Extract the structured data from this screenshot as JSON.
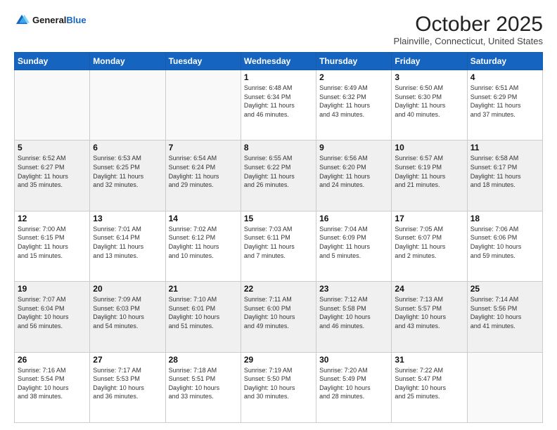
{
  "header": {
    "logo_general": "General",
    "logo_blue": "Blue",
    "month": "October 2025",
    "location": "Plainville, Connecticut, United States"
  },
  "weekdays": [
    "Sunday",
    "Monday",
    "Tuesday",
    "Wednesday",
    "Thursday",
    "Friday",
    "Saturday"
  ],
  "weeks": [
    [
      {
        "day": "",
        "info": ""
      },
      {
        "day": "",
        "info": ""
      },
      {
        "day": "",
        "info": ""
      },
      {
        "day": "1",
        "info": "Sunrise: 6:48 AM\nSunset: 6:34 PM\nDaylight: 11 hours\nand 46 minutes."
      },
      {
        "day": "2",
        "info": "Sunrise: 6:49 AM\nSunset: 6:32 PM\nDaylight: 11 hours\nand 43 minutes."
      },
      {
        "day": "3",
        "info": "Sunrise: 6:50 AM\nSunset: 6:30 PM\nDaylight: 11 hours\nand 40 minutes."
      },
      {
        "day": "4",
        "info": "Sunrise: 6:51 AM\nSunset: 6:29 PM\nDaylight: 11 hours\nand 37 minutes."
      }
    ],
    [
      {
        "day": "5",
        "info": "Sunrise: 6:52 AM\nSunset: 6:27 PM\nDaylight: 11 hours\nand 35 minutes."
      },
      {
        "day": "6",
        "info": "Sunrise: 6:53 AM\nSunset: 6:25 PM\nDaylight: 11 hours\nand 32 minutes."
      },
      {
        "day": "7",
        "info": "Sunrise: 6:54 AM\nSunset: 6:24 PM\nDaylight: 11 hours\nand 29 minutes."
      },
      {
        "day": "8",
        "info": "Sunrise: 6:55 AM\nSunset: 6:22 PM\nDaylight: 11 hours\nand 26 minutes."
      },
      {
        "day": "9",
        "info": "Sunrise: 6:56 AM\nSunset: 6:20 PM\nDaylight: 11 hours\nand 24 minutes."
      },
      {
        "day": "10",
        "info": "Sunrise: 6:57 AM\nSunset: 6:19 PM\nDaylight: 11 hours\nand 21 minutes."
      },
      {
        "day": "11",
        "info": "Sunrise: 6:58 AM\nSunset: 6:17 PM\nDaylight: 11 hours\nand 18 minutes."
      }
    ],
    [
      {
        "day": "12",
        "info": "Sunrise: 7:00 AM\nSunset: 6:15 PM\nDaylight: 11 hours\nand 15 minutes."
      },
      {
        "day": "13",
        "info": "Sunrise: 7:01 AM\nSunset: 6:14 PM\nDaylight: 11 hours\nand 13 minutes."
      },
      {
        "day": "14",
        "info": "Sunrise: 7:02 AM\nSunset: 6:12 PM\nDaylight: 11 hours\nand 10 minutes."
      },
      {
        "day": "15",
        "info": "Sunrise: 7:03 AM\nSunset: 6:11 PM\nDaylight: 11 hours\nand 7 minutes."
      },
      {
        "day": "16",
        "info": "Sunrise: 7:04 AM\nSunset: 6:09 PM\nDaylight: 11 hours\nand 5 minutes."
      },
      {
        "day": "17",
        "info": "Sunrise: 7:05 AM\nSunset: 6:07 PM\nDaylight: 11 hours\nand 2 minutes."
      },
      {
        "day": "18",
        "info": "Sunrise: 7:06 AM\nSunset: 6:06 PM\nDaylight: 10 hours\nand 59 minutes."
      }
    ],
    [
      {
        "day": "19",
        "info": "Sunrise: 7:07 AM\nSunset: 6:04 PM\nDaylight: 10 hours\nand 56 minutes."
      },
      {
        "day": "20",
        "info": "Sunrise: 7:09 AM\nSunset: 6:03 PM\nDaylight: 10 hours\nand 54 minutes."
      },
      {
        "day": "21",
        "info": "Sunrise: 7:10 AM\nSunset: 6:01 PM\nDaylight: 10 hours\nand 51 minutes."
      },
      {
        "day": "22",
        "info": "Sunrise: 7:11 AM\nSunset: 6:00 PM\nDaylight: 10 hours\nand 49 minutes."
      },
      {
        "day": "23",
        "info": "Sunrise: 7:12 AM\nSunset: 5:58 PM\nDaylight: 10 hours\nand 46 minutes."
      },
      {
        "day": "24",
        "info": "Sunrise: 7:13 AM\nSunset: 5:57 PM\nDaylight: 10 hours\nand 43 minutes."
      },
      {
        "day": "25",
        "info": "Sunrise: 7:14 AM\nSunset: 5:56 PM\nDaylight: 10 hours\nand 41 minutes."
      }
    ],
    [
      {
        "day": "26",
        "info": "Sunrise: 7:16 AM\nSunset: 5:54 PM\nDaylight: 10 hours\nand 38 minutes."
      },
      {
        "day": "27",
        "info": "Sunrise: 7:17 AM\nSunset: 5:53 PM\nDaylight: 10 hours\nand 36 minutes."
      },
      {
        "day": "28",
        "info": "Sunrise: 7:18 AM\nSunset: 5:51 PM\nDaylight: 10 hours\nand 33 minutes."
      },
      {
        "day": "29",
        "info": "Sunrise: 7:19 AM\nSunset: 5:50 PM\nDaylight: 10 hours\nand 30 minutes."
      },
      {
        "day": "30",
        "info": "Sunrise: 7:20 AM\nSunset: 5:49 PM\nDaylight: 10 hours\nand 28 minutes."
      },
      {
        "day": "31",
        "info": "Sunrise: 7:22 AM\nSunset: 5:47 PM\nDaylight: 10 hours\nand 25 minutes."
      },
      {
        "day": "",
        "info": ""
      }
    ]
  ]
}
